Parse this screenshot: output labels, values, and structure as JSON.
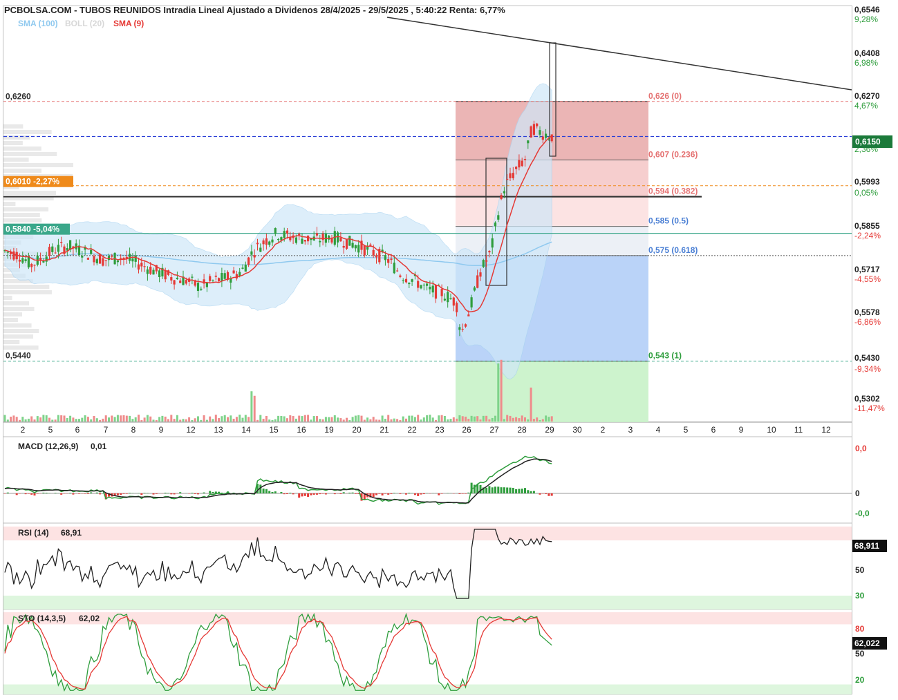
{
  "header": {
    "title": "PCBOLSA.COM - TUBOS REUNIDOS Intradia Lineal Ajustado a Dividenos 28/4/2025 - 29/5/2025 , 5:40:22 Renta: 6,77%",
    "legend": [
      {
        "text": "SMA (100)",
        "color": "#8fc9ef"
      },
      {
        "text": "BOLL (20)",
        "color": "#d7d7d7"
      },
      {
        "text": "SMA (9)",
        "color": "#e53935"
      }
    ]
  },
  "chart_data": [
    {
      "type": "candlestick",
      "name": "price",
      "x_tick_labels": [
        "2",
        "5",
        "6",
        "7",
        "8",
        "9",
        "12",
        "13",
        "14",
        "15",
        "16",
        "19",
        "20",
        "21",
        "22",
        "23",
        "26",
        "27",
        "28",
        "29",
        "30",
        "2",
        "3",
        "4",
        "5",
        "6",
        "9",
        "10",
        "11",
        "12"
      ],
      "y_axis": [
        {
          "price": "0,6546",
          "pct": "9,28%"
        },
        {
          "price": "0,6408",
          "pct": "6,98%"
        },
        {
          "price": "0,6270",
          "pct": "4,67%"
        },
        {
          "price": "0,6150",
          "pct": "2,36%"
        },
        {
          "price": "0,5993",
          "pct": "0,05%"
        },
        {
          "price": "0,5855",
          "pct": "-2,24%"
        },
        {
          "price": "0,5717",
          "pct": "-4,55%"
        },
        {
          "price": "0,5578",
          "pct": "-6,86%"
        },
        {
          "price": "0,5430",
          "pct": "-9,34%"
        },
        {
          "price": "0,5302",
          "pct": "-11,47%"
        }
      ],
      "ylim": [
        0.5262,
        0.6546
      ],
      "current_price_label": "0,6150",
      "left_levels": [
        {
          "text": "0,6260",
          "value": 0.626
        },
        {
          "text": "0,6010 -2,27%",
          "value": 0.5993
        },
        {
          "text": "0,5840 -5,04%",
          "value": 0.5841
        },
        {
          "text": "0,5440",
          "value": 0.5433
        }
      ],
      "fibonacci": [
        {
          "label": "0,626 (0)",
          "value": 0.6262
        },
        {
          "label": "0,607 (0.236)",
          "value": 0.6075
        },
        {
          "label": "0,594 (0.382)",
          "value": 0.5958
        },
        {
          "label": "0,585 (0.5)",
          "value": 0.5863
        },
        {
          "label": "0,575 (0.618)",
          "value": 0.577
        },
        {
          "label": "0,543 (1)",
          "value": 0.5433
        }
      ],
      "last_value": 0.615
    },
    {
      "type": "line",
      "name": "MACD",
      "label": "MACD (12,26,9)",
      "value": "0,01",
      "y_tick_labels": [
        "0,0",
        "0",
        "-0,0"
      ]
    },
    {
      "type": "line",
      "name": "RSI",
      "label": "RSI (14)",
      "value": "68,91",
      "current_label": "68,911",
      "y_tick_labels": [
        "50",
        "30"
      ],
      "ylim": [
        20,
        80
      ]
    },
    {
      "type": "line",
      "name": "STO",
      "label": "STO (14,3,5)",
      "value": "62,02",
      "current_label": "62,022",
      "y_tick_labels": [
        "80",
        "50",
        "20"
      ],
      "ylim": [
        10,
        92
      ]
    }
  ]
}
